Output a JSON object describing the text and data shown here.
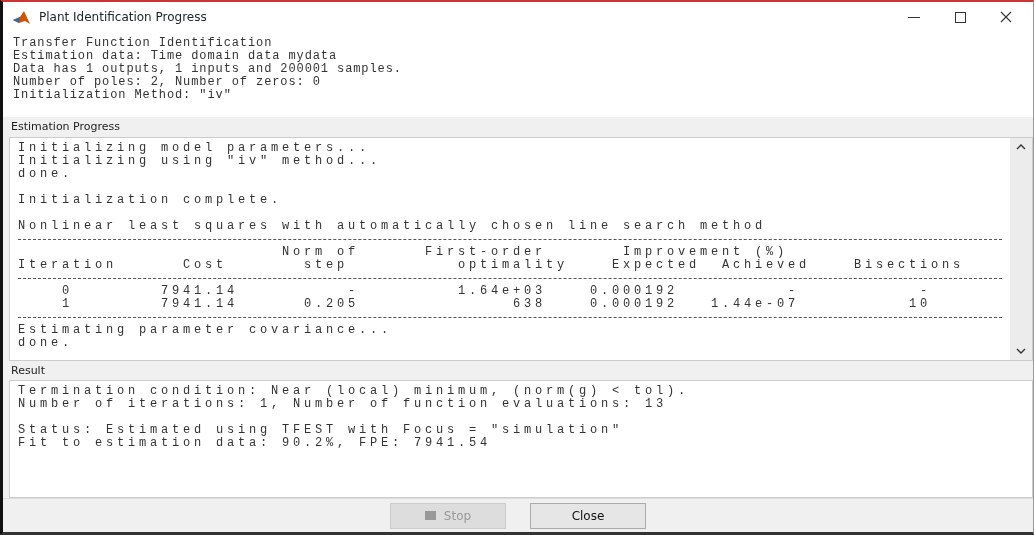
{
  "window": {
    "title": "Plant Identification Progress"
  },
  "header_lines": [
    "Transfer Function Identification",
    "Estimation data: Time domain data mydata",
    "Data has 1 outputs, 1 inputs and 200001 samples.",
    "Number of poles: 2, Number of zeros: 0",
    "Initialization Method: \"iv\""
  ],
  "estimation_progress": {
    "title": "Estimation Progress",
    "lines": [
      {
        "kind": "text",
        "text": "Initializing model parameters..."
      },
      {
        "kind": "text",
        "text": "Initializing using \"iv\" method..."
      },
      {
        "kind": "text",
        "text": "done."
      },
      {
        "kind": "blank"
      },
      {
        "kind": "text",
        "text": "Initialization complete."
      },
      {
        "kind": "blank"
      },
      {
        "kind": "text",
        "text": "Nonlinear least squares with automatically chosen line search method"
      },
      {
        "kind": "rule"
      },
      {
        "kind": "header",
        "text": "                        Norm of      First-order       Improvement (%)"
      },
      {
        "kind": "header",
        "text": "Iteration      Cost       step          optimality    Expected  Achieved    Bisections"
      },
      {
        "kind": "rule"
      },
      {
        "kind": "row",
        "text": "    0        7941.14          -         1.64e+03    0.000192          -           -"
      },
      {
        "kind": "row",
        "text": "    1        7941.14      0.205              638    0.000192   1.44e-07          10"
      },
      {
        "kind": "rule"
      },
      {
        "kind": "text",
        "text": "Estimating parameter covariance..."
      },
      {
        "kind": "text",
        "text": "done."
      }
    ]
  },
  "result": {
    "title": "Result",
    "lines": [
      {
        "kind": "text",
        "text": "Termination condition: Near (local) minimum, (norm(g) < tol)."
      },
      {
        "kind": "text",
        "text": "Number of iterations: 1, Number of function evaluations: 13"
      },
      {
        "kind": "blank"
      },
      {
        "kind": "text",
        "text": "Status: Estimated using TFEST with Focus = \"simulation\""
      },
      {
        "kind": "text",
        "text": "Fit to estimation data: 90.2%, FPE: 7941.54"
      }
    ]
  },
  "buttons": [
    {
      "label": "Stop",
      "disabled": true
    },
    {
      "label": "Close",
      "disabled": false
    }
  ]
}
